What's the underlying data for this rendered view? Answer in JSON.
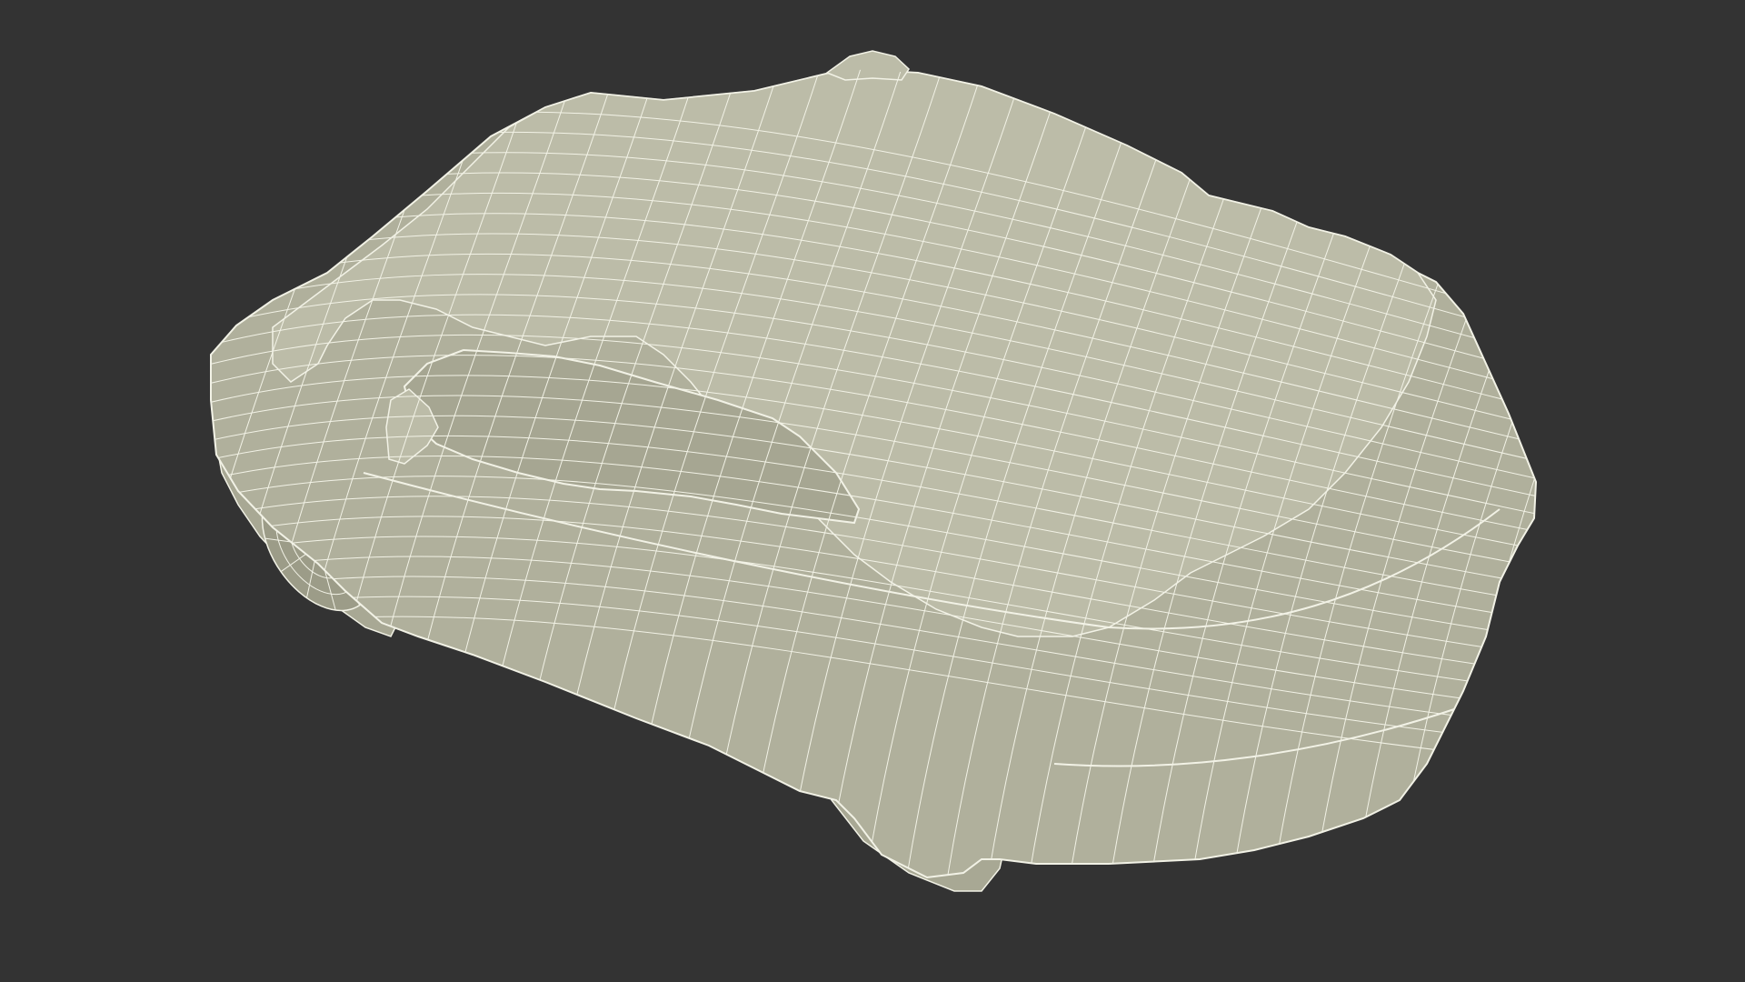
{
  "colors": {
    "background": "#333333",
    "mesh_fill": "#b0b09c",
    "mesh_fill_light": "#bcbca8",
    "mesh_fill_dark": "#9c9c88",
    "window_fill": "#a6a692",
    "tire_fill": "#a8a894",
    "wire": "#f2f2e6",
    "edge": "#5a5a50"
  }
}
